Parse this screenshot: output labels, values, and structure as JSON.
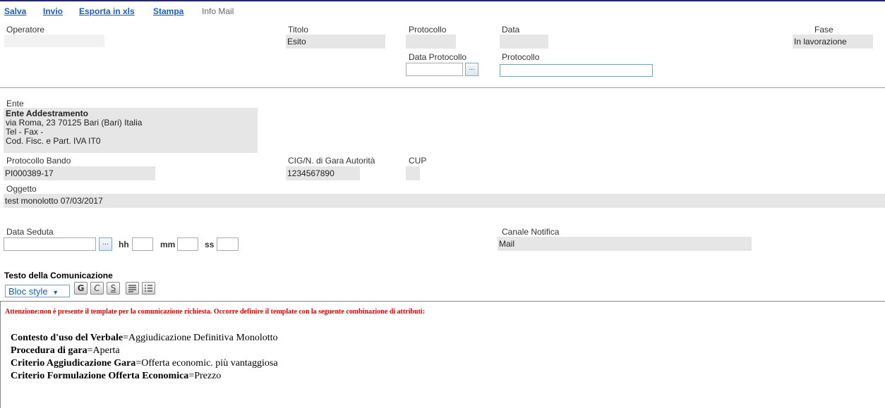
{
  "toolbar": {
    "salva": "Salva",
    "invio": "Invio",
    "esporta": "Esporta in xls",
    "stampa": "Stampa",
    "info_mail": "Info Mail"
  },
  "header": {
    "operatore_label": "Operatore",
    "operatore_value": "",
    "titolo_label": "Titolo",
    "titolo_value": "Esito",
    "protocollo_label": "Protocollo",
    "protocollo_value": "",
    "data_label": "Data",
    "data_value": "",
    "fase_label": "Fase",
    "fase_value": "In lavorazione",
    "data_protocollo_label": "Data Protocollo",
    "data_protocollo_value": "",
    "protocollo2_label": "Protocollo",
    "protocollo2_value": "",
    "dots": "..."
  },
  "ente": {
    "label": "Ente",
    "name": "Ente Addestramento",
    "address": "via Roma, 23 70125 Bari (Bari) Italia",
    "tel_fax": "Tel - Fax -",
    "cod_fisc": "Cod. Fisc. e Part. IVA IT0"
  },
  "bando": {
    "protocollo_label": "Protocollo Bando",
    "protocollo_value": "PI000389-17",
    "cig_label": "CIG/N. di Gara Autorità",
    "cig_value": "1234567890",
    "cup_label": "CUP",
    "cup_value": "",
    "oggetto_label": "Oggetto",
    "oggetto_value": "test monolotto 07/03/2017"
  },
  "seduta": {
    "data_label": "Data Seduta",
    "hh_label": "hh",
    "mm_label": "mm",
    "ss_label": "ss",
    "dots": "...",
    "canale_label": "Canale Notifica",
    "canale_value": "Mail"
  },
  "comunicazione": {
    "label": "Testo della Comunicazione",
    "bloc_style": "Bloc style",
    "bloc_arrow": "▼",
    "btn_bold": "G",
    "btn_italic": "C",
    "btn_strike": "S",
    "warning": "Attenzione:non è presente il template per la comunicazione richiesta. Occorre definire il template con la seguente combinazione di attributi:",
    "attributes": [
      {
        "key": "Contesto d'uso del Verbale",
        "value": "Aggiudicazione Definitiva Monolotto"
      },
      {
        "key": "Procedura di gara",
        "value": "Aperta"
      },
      {
        "key": "Criterio Aggiudicazione Gara",
        "value": "Offerta economic. più vantaggiosa"
      },
      {
        "key": "Criterio Formulazione Offerta Economica",
        "value": "Prezzo"
      }
    ]
  }
}
